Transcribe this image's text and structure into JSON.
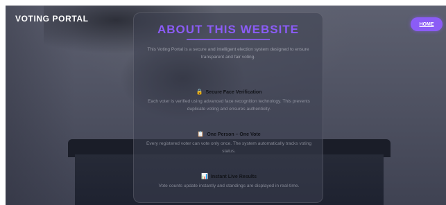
{
  "header": {
    "logo": "VOTING PORTAL",
    "home_label": "HOME"
  },
  "about": {
    "title": "ABOUT THIS WEBSITE",
    "intro": "This Voting Portal is a secure and intelligent election system designed to ensure transparent and fair voting.",
    "features": [
      {
        "icon": "lock-icon",
        "glyph": "🔒",
        "title": "Secure Face Verification",
        "description": "Each voter is verified using advanced face recognition technology. This prevents duplicate voting and ensures authenticity."
      },
      {
        "icon": "clipboard-icon",
        "glyph": "📋",
        "title": "One Person – One Vote",
        "description": "Every registered voter can vote only once. The system automatically tracks voting status."
      },
      {
        "icon": "chart-icon",
        "glyph": "📊",
        "title": "Instant Live Results",
        "description": "Vote counts update instantly and standings are displayed in real-time."
      }
    ]
  },
  "colors": {
    "accent": "#8b5cf6",
    "background": "#4d5060"
  }
}
